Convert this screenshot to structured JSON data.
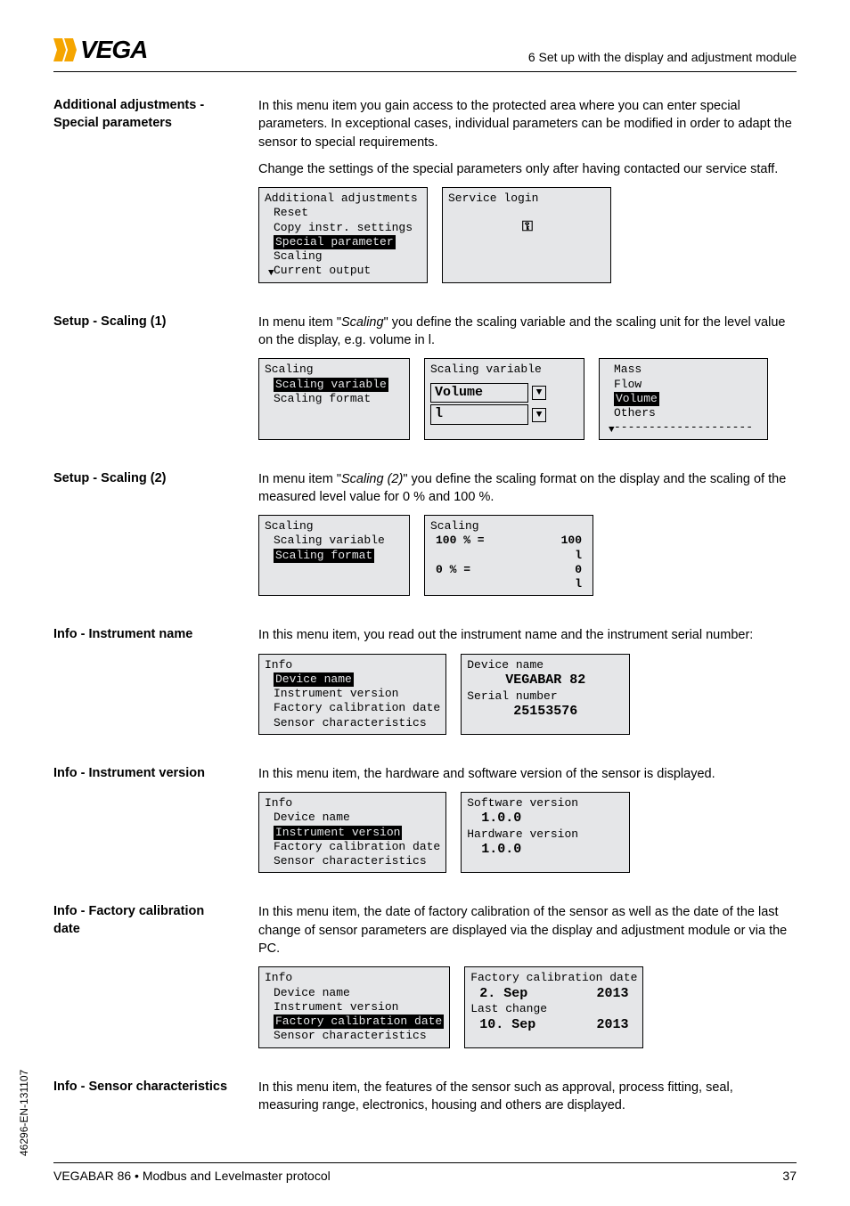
{
  "header": {
    "logo_text": "VEGA",
    "section_title": "6 Set up with the display and adjustment module"
  },
  "sections": {
    "additional": {
      "label": "Additional adjustments - Special parameters",
      "p1": "In this menu item you gain access to the protected area where you can enter special parameters. In exceptional cases, individual parameters can be modified in order to adapt the sensor to special requirements.",
      "p2": "Change the settings of the special parameters only after having contacted our service staff.",
      "lcd1": {
        "title": "Additional adjustments",
        "l1": "Reset",
        "l2": "Copy instr. settings",
        "sel": "Special parameter",
        "l4": "Scaling",
        "l5": "Current output"
      },
      "lcd2": {
        "title": "Service login",
        "icon": "🔑"
      }
    },
    "scaling1": {
      "label": "Setup - Scaling (1)",
      "p1_pre": "In menu item \"",
      "p1_em": "Scaling",
      "p1_post": "\" you define the scaling variable and the scaling unit for the level value on the display, e.g. volume in l.",
      "lcd1": {
        "title": "Scaling",
        "sel": "Scaling variable",
        "l2": "Scaling format"
      },
      "lcd2": {
        "title": "Scaling variable",
        "value": "Volume",
        "unit": "l"
      },
      "lcd3": {
        "l1": "Mass",
        "l2": "Flow",
        "sel": "Volume",
        "l4": "Others",
        "dash": "--------------------"
      }
    },
    "scaling2": {
      "label": "Setup - Scaling (2)",
      "p1_pre": "In menu item \"",
      "p1_em": "Scaling (2)",
      "p1_post": "\" you define the scaling format on the display and the scaling of the measured level value for 0 % and 100 %.",
      "lcd1": {
        "title": "Scaling",
        "l1": "Scaling variable",
        "sel": "Scaling format"
      },
      "lcd2": {
        "title": "Scaling",
        "r1l": "100 % =",
        "r1r": "100",
        "r1u": "l",
        "r2l": "0 % =",
        "r2r": "0",
        "r2u": "l"
      }
    },
    "instr_name": {
      "label": "Info - Instrument name",
      "p1": "In this menu item, you read out the instrument name and the instrument serial number:",
      "lcd1": {
        "title": "Info",
        "sel": "Device name",
        "l2": "Instrument version",
        "l3": "Factory calibration date",
        "l4": "Sensor characteristics"
      },
      "lcd2": {
        "t1": "Device name",
        "v1": "VEGABAR 82",
        "t2": "Serial number",
        "v2": "25153576"
      }
    },
    "instr_ver": {
      "label": "Info - Instrument version",
      "p1": "In this menu item, the hardware and software version of the sensor is displayed.",
      "lcd1": {
        "title": "Info",
        "l1": "Device name",
        "sel": "Instrument version",
        "l3": "Factory calibration date",
        "l4": "Sensor characteristics"
      },
      "lcd2": {
        "t1": "Software version",
        "v1": "1.0.0",
        "t2": "Hardware version",
        "v2": "1.0.0"
      }
    },
    "fac_cal": {
      "label": "Info - Factory calibration date",
      "p1": "In this menu item, the date of factory calibration of the sensor as well as the date of the last change of sensor parameters are displayed via the display and adjustment module or via the PC.",
      "lcd1": {
        "title": "Info",
        "l1": "Device name",
        "l2": "Instrument version",
        "sel": "Factory calibration date",
        "l4": "Sensor characteristics"
      },
      "lcd2": {
        "t1": "Factory calibration date",
        "v1a": "2. Sep",
        "v1b": "2013",
        "t2": "Last change",
        "v2a": "10. Sep",
        "v2b": "2013"
      }
    },
    "sensor_char": {
      "label": "Info - Sensor characteristics",
      "p1": "In this menu item, the features of the sensor such as approval, process fitting, seal, measuring range, electronics, housing and others are displayed."
    }
  },
  "footer": {
    "left": "VEGABAR 86 • Modbus and Levelmaster protocol",
    "right": "37"
  },
  "side": "46296-EN-131107"
}
